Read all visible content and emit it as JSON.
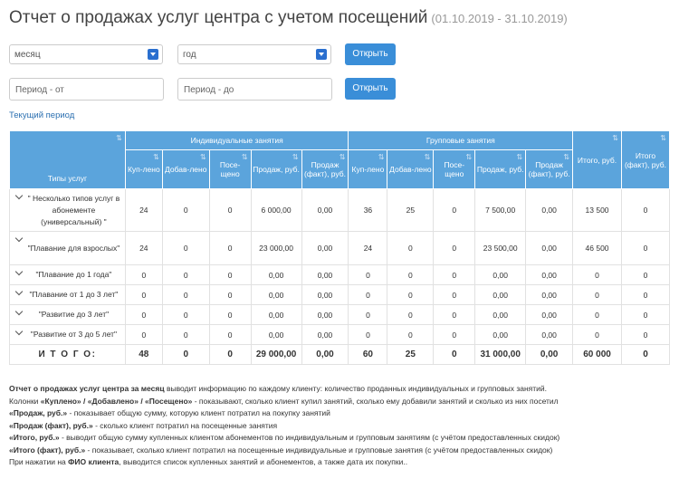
{
  "header": {
    "title": "Отчет о продажах услуг центра с учетом посещений",
    "period": "(01.10.2019 - 31.10.2019)"
  },
  "filters": {
    "month_select": "месяц",
    "year_select": "год",
    "open_button": "Открыть",
    "period_from_placeholder": "Период - от",
    "period_to_placeholder": "Период - до",
    "open_button_2": "Открыть",
    "current_period_link": "Текущий период"
  },
  "table": {
    "group_headers": {
      "types": "Типы услуг",
      "individual": "Индивидуальные занятия",
      "group": "Групповые занятия",
      "total": "Итого, руб.",
      "total_fact": "Итого (факт), руб."
    },
    "sub_headers": [
      "Куп-лено",
      "Добав-лено",
      "Посе-щено",
      "Продаж, руб.",
      "Продаж (факт), руб.",
      "Куп-лено",
      "Добав-лено",
      "Посе-щено",
      "Продаж, руб.",
      "Продаж (факт), руб."
    ],
    "rows": [
      {
        "label": "\" Несколько типов услуг в абонементе (универсальный) \"",
        "cells": [
          "24",
          "0",
          "0",
          "6 000,00",
          "0,00",
          "36",
          "25",
          "0",
          "7 500,00",
          "0,00",
          "13 500",
          "0"
        ]
      },
      {
        "label": "\"Плавание для взрослых\"",
        "cells": [
          "24",
          "0",
          "0",
          "23 000,00",
          "0,00",
          "24",
          "0",
          "0",
          "23 500,00",
          "0,00",
          "46 500",
          "0"
        ]
      },
      {
        "label": "\"Плавание до 1 года\"",
        "cells": [
          "0",
          "0",
          "0",
          "0,00",
          "0,00",
          "0",
          "0",
          "0",
          "0,00",
          "0,00",
          "0",
          "0"
        ]
      },
      {
        "label": "\"Плавание от 1 до 3 лет\"",
        "cells": [
          "0",
          "0",
          "0",
          "0,00",
          "0,00",
          "0",
          "0",
          "0",
          "0,00",
          "0,00",
          "0",
          "0"
        ]
      },
      {
        "label": "\"Развитие до 3 лет\"",
        "cells": [
          "0",
          "0",
          "0",
          "0,00",
          "0,00",
          "0",
          "0",
          "0",
          "0,00",
          "0,00",
          "0",
          "0"
        ]
      },
      {
        "label": "\"Развитие от 3 до 5 лет\"",
        "cells": [
          "0",
          "0",
          "0",
          "0,00",
          "0,00",
          "0",
          "0",
          "0",
          "0,00",
          "0,00",
          "0",
          "0"
        ]
      }
    ],
    "total": {
      "label": "И Т О Г О:",
      "cells": [
        "48",
        "0",
        "0",
        "29 000,00",
        "0,00",
        "60",
        "25",
        "0",
        "31 000,00",
        "0,00",
        "60 000",
        "0"
      ]
    }
  },
  "description": {
    "l1_b": "Отчет о продажах услуг центра за месяц",
    "l1": " выводит информацию по каждому клиенту: количество проданных индивидуальных и групповых занятий.",
    "l2_a": "Колонки ",
    "l2_b": "«Куплено» / «Добавлено» / «Посещено»",
    "l2": " - показывают, сколько клиент купил занятий, сколько ему добавили занятий и сколько из них посетил",
    "l3_b": "«Продаж, руб.»",
    "l3": " - показывает общую сумму, которую клиент потратил на покупку занятий",
    "l4_b": "«Продаж (факт), руб.»",
    "l4": " - сколько клиент потратил на посещенные занятия",
    "l5_b": "«Итого, руб.»",
    "l5": " - выводит общую сумму купленных клиентом абонементов по индивидуальным и групповым занятиям (с учётом предоставленных скидок)",
    "l6_b": "«Итого (факт), руб.»",
    "l6": " - показывает, сколько клиент потратил на посещенные индивидуальные и групповые занятия (с учётом предоставленных скидок)",
    "l7_a": "При нажатии на ",
    "l7_b": "ФИО клиента",
    "l7": ", выводится список купленных занятий и абонементов, а также дата их покупки.."
  }
}
